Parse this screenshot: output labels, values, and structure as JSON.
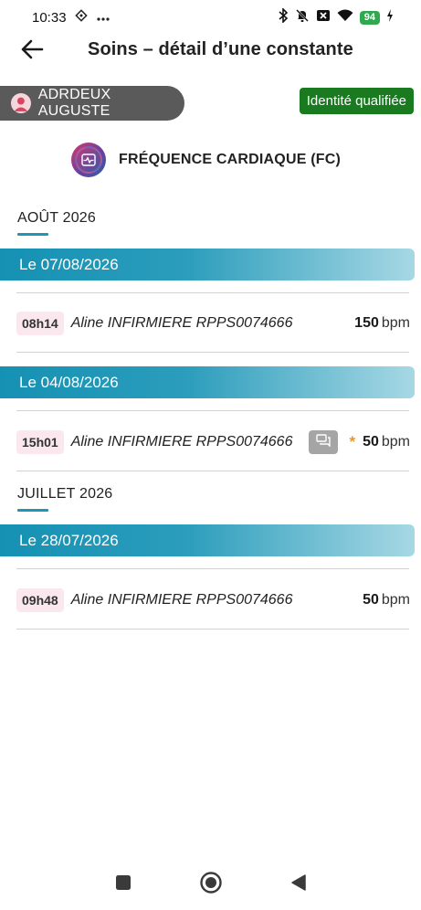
{
  "status_bar": {
    "time": "10:33",
    "battery": "94"
  },
  "app_bar": {
    "title": "Soins – détail d’une constante"
  },
  "patient": {
    "name": "ADRDEUX AUGUSTE",
    "identity_status": "Identité qualifiée"
  },
  "constant": {
    "title": "FRÉQUENCE CARDIAQUE (FC)"
  },
  "months": [
    {
      "label": "AOÛT 2026",
      "days": [
        {
          "date_label": "Le 07/08/2026",
          "entries": [
            {
              "time": "08h14",
              "author": "Aline INFIRMIERE RPPS0074666",
              "value": "150",
              "unit": "bpm",
              "has_comment": false,
              "flag": ""
            }
          ]
        },
        {
          "date_label": "Le 04/08/2026",
          "entries": [
            {
              "time": "15h01",
              "author": "Aline INFIRMIERE RPPS0074666",
              "value": "50",
              "unit": "bpm",
              "has_comment": true,
              "flag": "*"
            }
          ]
        }
      ]
    },
    {
      "label": "JUILLET 2026",
      "days": [
        {
          "date_label": "Le 28/07/2026",
          "entries": [
            {
              "time": "09h48",
              "author": "Aline INFIRMIERE RPPS0074666",
              "value": "50",
              "unit": "bpm",
              "has_comment": false,
              "flag": ""
            }
          ]
        }
      ]
    }
  ],
  "colors": {
    "accent": "#1591b3",
    "identity_badge": "#1a7a1f",
    "patient_chip": "#5a5a5a",
    "time_chip": "#fbe8ee",
    "flag": "#e39a2d"
  },
  "icons": {
    "back": "arrow-left-icon",
    "constant": "heart-rate-icon",
    "comment": "comment-icon",
    "nav_recents": "square-icon",
    "nav_home": "circle-icon",
    "nav_back": "triangle-icon"
  }
}
